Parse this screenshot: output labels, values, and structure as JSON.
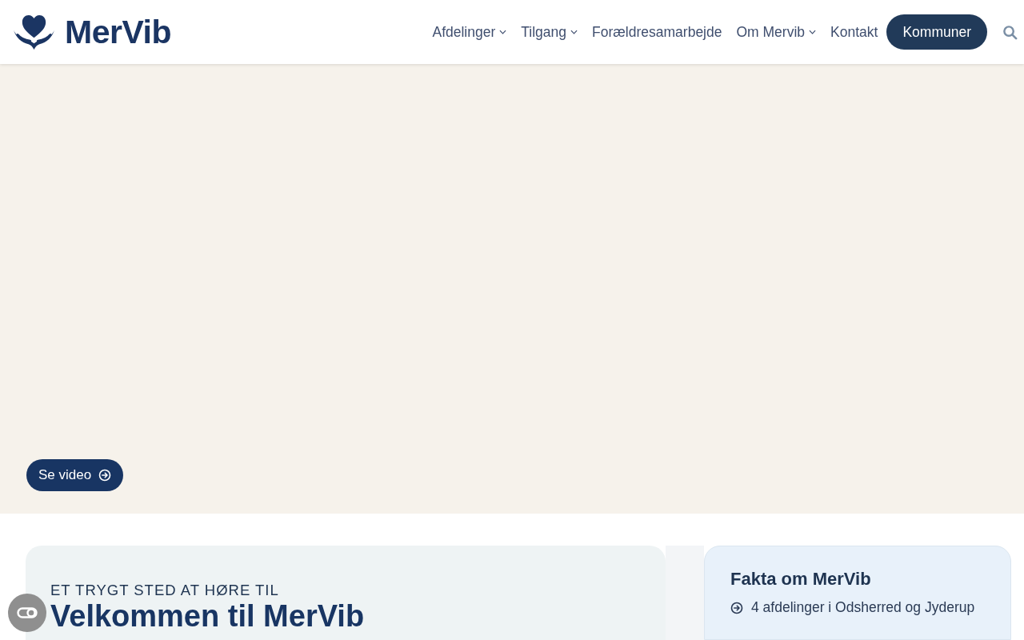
{
  "header": {
    "logo": "MerVib",
    "nav": [
      {
        "label": "Afdelinger",
        "dropdown": true
      },
      {
        "label": "Tilgang",
        "dropdown": true
      },
      {
        "label": "Forældresamarbejde",
        "dropdown": false
      },
      {
        "label": "Om Mervib",
        "dropdown": true
      },
      {
        "label": "Kontakt",
        "dropdown": false
      }
    ],
    "cta": "Kommuner"
  },
  "hero": {
    "button": "Se video"
  },
  "intro": {
    "eyebrow": "ET TRYGT STED AT HØRE TIL",
    "heading": "Velkommen til MerVib"
  },
  "facts": {
    "title": "Fakta om MerVib",
    "items": [
      "4 afdelinger i Odsherred og Jyderup"
    ]
  }
}
